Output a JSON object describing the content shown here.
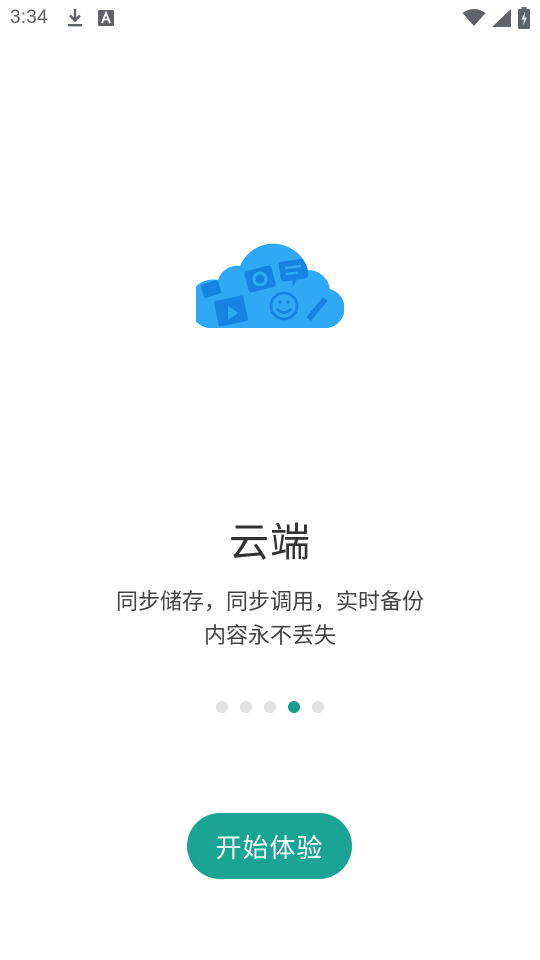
{
  "status_bar": {
    "time": "3:34",
    "left_icons": [
      "download-icon",
      "a-badge-icon"
    ],
    "right_icons": [
      "wifi-icon",
      "cellular-signal-icon",
      "battery-charging-icon"
    ]
  },
  "onboarding": {
    "illustration": "cloud-icon",
    "title": "云端",
    "description_line1": "同步储存，同步调用，实时备份",
    "description_line2": "内容永不丢失",
    "page_count": 5,
    "active_page": 4,
    "start_button_label": "开始体验"
  },
  "colors": {
    "accent": "#1ba394",
    "active_dot": "#1a9e8f",
    "inactive_dot": "#e3e3e3",
    "cloud": "#2fa9f5",
    "cloud_dark": "#1584e0"
  }
}
